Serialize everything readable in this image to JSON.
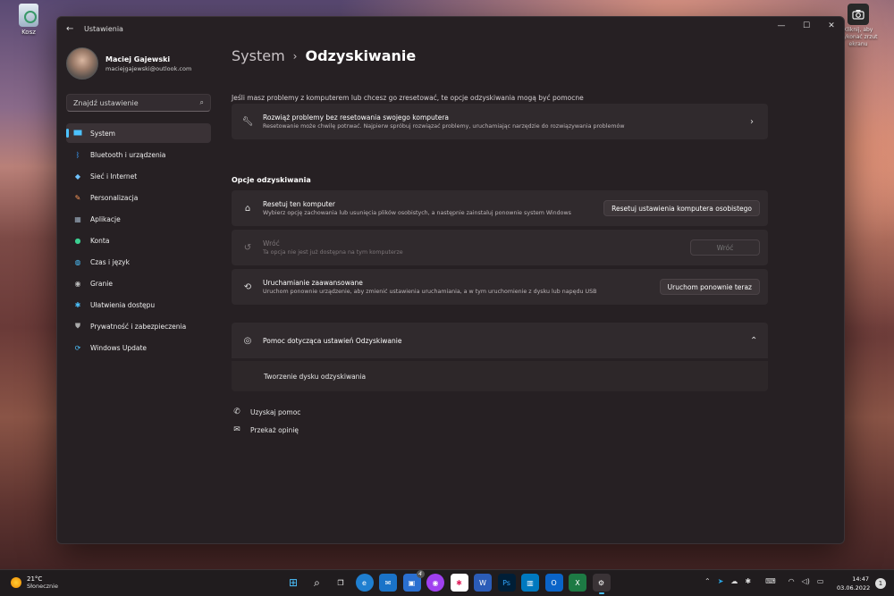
{
  "desktop": {
    "recycle_bin_label": "Kosz",
    "screenshot_label": "Kliknij, aby wykonać zrzut ekranu"
  },
  "window": {
    "title": "Ustawienia",
    "controls": [
      "minimize-icon",
      "maximize-icon",
      "close-icon"
    ]
  },
  "profile": {
    "name": "Maciej Gajewski",
    "email": "maciejgajewski@outlook.com"
  },
  "search": {
    "placeholder": "Znajdź ustawienie"
  },
  "sidebar": {
    "items": [
      {
        "label": "System",
        "icon": "monitor-icon",
        "active": true
      },
      {
        "label": "Bluetooth i urządzenia",
        "icon": "bluetooth-icon"
      },
      {
        "label": "Sieć i Internet",
        "icon": "wifi-icon"
      },
      {
        "label": "Personalizacja",
        "icon": "brush-icon"
      },
      {
        "label": "Aplikacje",
        "icon": "apps-icon"
      },
      {
        "label": "Konta",
        "icon": "person-icon"
      },
      {
        "label": "Czas i język",
        "icon": "globe-clock-icon"
      },
      {
        "label": "Granie",
        "icon": "gamepad-icon"
      },
      {
        "label": "Ułatwienia dostępu",
        "icon": "accessibility-icon"
      },
      {
        "label": "Prywatność i zabezpieczenia",
        "icon": "shield-icon"
      },
      {
        "label": "Windows Update",
        "icon": "update-icon"
      }
    ]
  },
  "main": {
    "breadcrumb": {
      "parent": "System",
      "separator": "›",
      "current": "Odzyskiwanie"
    },
    "description": "Jeśli masz problemy z komputerem lub chcesz go zresetować, te opcje odzyskiwania mogą być pomocne",
    "troubleshoot": {
      "title": "Rozwiąż problemy bez resetowania swojego komputera",
      "subtitle": "Resetowanie może chwilę potrwać. Najpierw spróbuj rozwiązać problemy, uruchamiając narzędzie do rozwiązywania problemów"
    },
    "section_title": "Opcje odzyskiwania",
    "reset": {
      "title": "Resetuj ten komputer",
      "subtitle": "Wybierz opcję zachowania lub usunięcia plików osobistych, a następnie zainstaluj ponownie system Windows",
      "button": "Resetuj ustawienia komputera osobistego"
    },
    "goback": {
      "title": "Wróć",
      "subtitle": "Ta opcja nie jest już dostępna na tym komputerze",
      "button": "Wróć"
    },
    "advanced": {
      "title": "Uruchamianie zaawansowane",
      "subtitle": "Uruchom ponownie urządzenie, aby zmienić ustawienia uruchamiania, a w tym uruchomienie z dysku lub napędu USB",
      "button": "Uruchom ponownie teraz"
    },
    "help": {
      "title": "Pomoc dotycząca ustawień Odzyskiwanie",
      "item": "Tworzenie dysku odzyskiwania"
    },
    "links": {
      "get_help": "Uzyskaj pomoc",
      "feedback": "Przekaż opinię"
    }
  },
  "taskbar": {
    "weather_temp": "21°C",
    "weather_cond": "Słonecznie",
    "time": "14:47",
    "date": "03.06.2022",
    "notifications": "1",
    "store_badge": "4",
    "accent": "#4cc2ff"
  }
}
